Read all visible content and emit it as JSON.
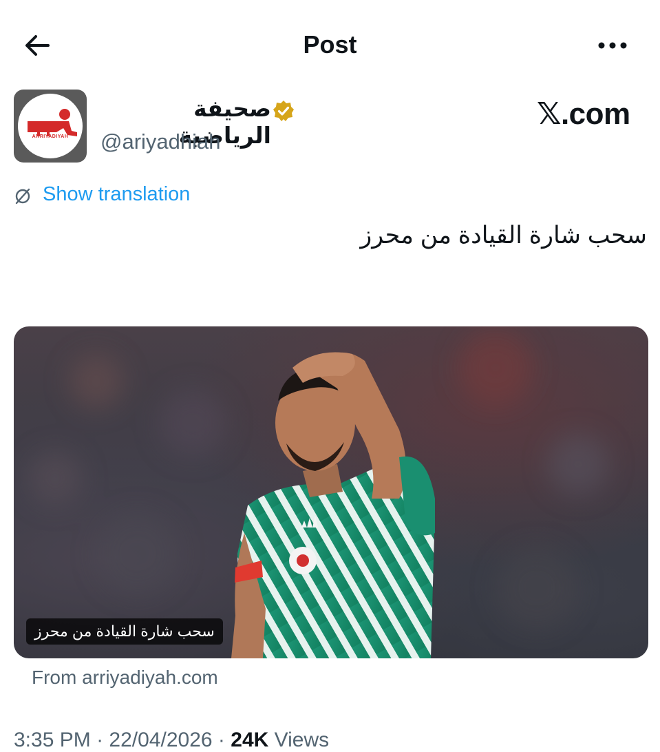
{
  "header": {
    "title": "Post",
    "back_icon": "arrow-left-icon",
    "more_icon": "more-horizontal-icon"
  },
  "author": {
    "display_name": "صحيفة الرياضية",
    "handle": "@ariyadhiah",
    "verified_icon": "verified-gold-badge-icon",
    "avatar_logo_text": "ARRIYADIYAH",
    "verified_color": "#d6a51a"
  },
  "watermark": "𝕏.com",
  "translation": {
    "label": "Show translation",
    "icon": "translate-icon",
    "color": "#1d9bf0"
  },
  "post": {
    "text": "سحب شارة القيادة من محرز"
  },
  "media": {
    "caption": "سحب شارة القيادة من محرز",
    "source": "From arriyadiyah.com"
  },
  "meta": {
    "time": "3:35 PM",
    "date": "22/04/2026",
    "views_count": "24K",
    "views_label": "Views"
  }
}
